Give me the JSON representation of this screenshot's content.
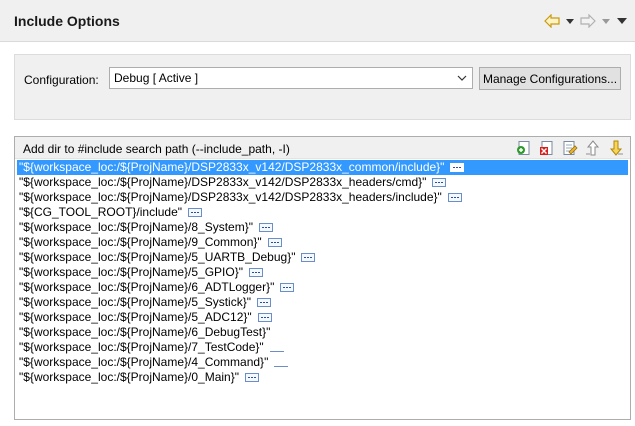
{
  "page": {
    "title": "Include Options"
  },
  "nav": {
    "back_icon": "back-arrow-icon",
    "forward_icon": "forward-arrow-icon",
    "menu_icon": "view-menu-icon"
  },
  "configuration": {
    "label": "Configuration:",
    "selected": "Debug  [ Active ]",
    "manage_label": "Manage Configurations..."
  },
  "include_list": {
    "title": "Add dir to #include search path (--include_path, -I)",
    "tools": [
      "add-icon",
      "delete-icon",
      "edit-icon",
      "move-up-icon",
      "move-down-icon"
    ],
    "selected_index": 0,
    "items": [
      {
        "path": "\"${workspace_loc:/${ProjName}/DSP2833x_v142/DSP2833x_common/include}\"",
        "marker": "ellipsis"
      },
      {
        "path": "\"${workspace_loc:/${ProjName}/DSP2833x_v142/DSP2833x_headers/cmd}\"",
        "marker": "ellipsis"
      },
      {
        "path": "\"${workspace_loc:/${ProjName}/DSP2833x_v142/DSP2833x_headers/include}\"",
        "marker": "ellipsis"
      },
      {
        "path": "\"${CG_TOOL_ROOT}/include\"",
        "marker": "ellipsis"
      },
      {
        "path": "\"${workspace_loc:/${ProjName}/8_System}\"",
        "marker": "ellipsis"
      },
      {
        "path": "\"${workspace_loc:/${ProjName}/9_Common}\"",
        "marker": "ellipsis"
      },
      {
        "path": "\"${workspace_loc:/${ProjName}/5_UARTB_Debug}\"",
        "marker": "ellipsis"
      },
      {
        "path": "\"${workspace_loc:/${ProjName}/5_GPIO}\"",
        "marker": "ellipsis"
      },
      {
        "path": "\"${workspace_loc:/${ProjName}/6_ADTLogger}\"",
        "marker": "ellipsis"
      },
      {
        "path": "\"${workspace_loc:/${ProjName}/5_Systick}\"",
        "marker": "ellipsis"
      },
      {
        "path": "\"${workspace_loc:/${ProjName}/5_ADC12}\"",
        "marker": "ellipsis"
      },
      {
        "path": "\"${workspace_loc:/${ProjName}/6_DebugTest}\"",
        "marker": "none"
      },
      {
        "path": "\"${workspace_loc:/${ProjName}/7_TestCode}\"",
        "marker": "underline"
      },
      {
        "path": "\"${workspace_loc:/${ProjName}/4_Command}\"",
        "marker": "underline"
      },
      {
        "path": "\"${workspace_loc:/${ProjName}/0_Main}\"",
        "marker": "ellipsis"
      }
    ]
  },
  "colors": {
    "selection": "#3399ff",
    "panel_bg": "#f0f0f0"
  }
}
